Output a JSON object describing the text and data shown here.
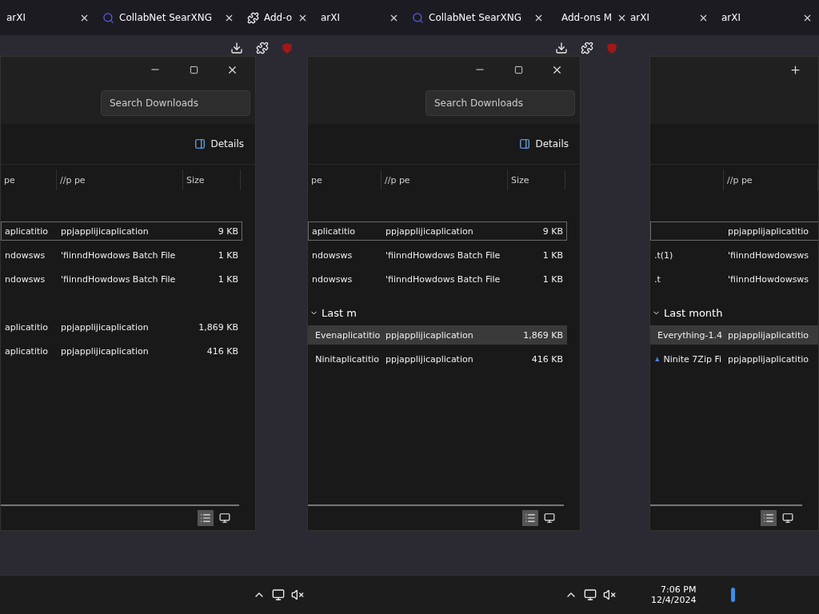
{
  "tabs": [
    {
      "label": "arXI",
      "kind": "plain"
    },
    {
      "label": "CollabNet SearXNG",
      "kind": "search"
    },
    {
      "label": "Add-o",
      "kind": "addon"
    },
    {
      "label": "arXI",
      "kind": "plain"
    },
    {
      "label": "CollabNet SearXNG",
      "kind": "search"
    },
    {
      "label": "Add-ons M",
      "kind": "addon"
    },
    {
      "label": "arXI",
      "kind": "plain"
    },
    {
      "label": "arXI",
      "kind": "plain"
    }
  ],
  "windows": [
    {
      "controls": true,
      "search": {
        "placeholder": "Search Downloads"
      },
      "view_button": "Details",
      "columns": [
        "pe",
        "//p pe",
        "Size"
      ],
      "rows": [
        {
          "cells": [
            "aplicatitio",
            "ppjapplijicaplication",
            "9 KB"
          ],
          "selected": true
        },
        {
          "cells": [
            "ndowsws",
            "'fiinndHowdows Batch File",
            "1 KB"
          ],
          "selected": false
        },
        {
          "cells": [
            "ndowsws",
            "'fiinndHowdows Batch File",
            "1 KB"
          ],
          "selected": false
        }
      ],
      "groups": [
        {
          "rows": [
            {
              "cells": [
                "aplicatitio",
                "ppjapplijicaplication",
                "1,869 KB"
              ],
              "selected": false,
              "kind": "plain"
            },
            {
              "cells": [
                "aplicatitio",
                "ppjapplijicaplication",
                "416 KB"
              ],
              "selected": false,
              "kind": "plain"
            }
          ]
        }
      ]
    },
    {
      "controls": true,
      "search": {
        "placeholder": "Search Downloads"
      },
      "view_button": "Details",
      "columns": [
        "pe",
        "//p pe",
        "Size"
      ],
      "rows": [
        {
          "cells": [
            "aplicatitio",
            "ppjapplijicaplication",
            "9 KB"
          ],
          "selected": true
        },
        {
          "cells": [
            "ndowsws",
            "'fiinndHowdows Batch File",
            "1 KB"
          ],
          "selected": false
        },
        {
          "cells": [
            "ndowsws",
            "'fiinndHowdows Batch File",
            "1 KB"
          ],
          "selected": false
        }
      ],
      "groups": [
        {
          "label": "Last m",
          "rows": [
            {
              "cells": [
                "Evenaplicatitio",
                "ppjapplijicaplication",
                "1,869 KB"
              ],
              "selected": true,
              "kind": "search-app"
            },
            {
              "cells": [
                "Ninitaplicatitio",
                "ppjapplijicaplication",
                "416 KB"
              ],
              "selected": false,
              "kind": "installer"
            }
          ]
        }
      ]
    },
    {
      "controls": false,
      "columns": [
        "",
        "//p pe"
      ],
      "rows": [
        {
          "cells": [
            "",
            "ppjapplijaplicatitio"
          ],
          "selected": true
        },
        {
          "cells": [
            ".t(1)",
            "'fiinndHowdowsws"
          ],
          "selected": false
        },
        {
          "cells": [
            ".t",
            "'fiinndHowdowsws"
          ],
          "selected": false
        }
      ],
      "groups": [
        {
          "label": "Last month",
          "rows": [
            {
              "cells": [
                "Everything-1.4",
                "ppjapplijaplicatitio"
              ],
              "selected": true,
              "kind": "search-app"
            },
            {
              "cells": [
                "Ninite 7Zip Fi",
                "ppjapplijaplicatitio"
              ],
              "selected": false,
              "kind": "installer"
            }
          ]
        }
      ]
    }
  ],
  "taskbar": {
    "time": "7:06 PM",
    "date": "12/4/2024"
  }
}
